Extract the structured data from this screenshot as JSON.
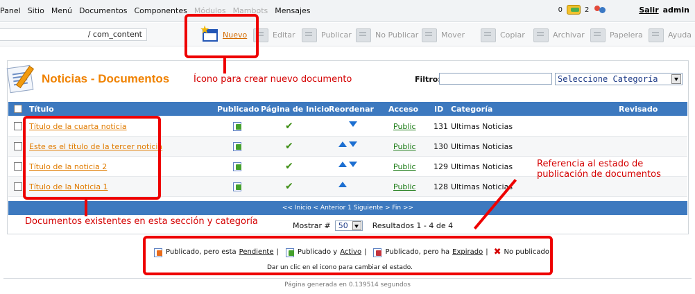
{
  "menu": {
    "items": [
      "Panel",
      "Sitio",
      "Menú",
      "Documentos",
      "Componentes"
    ],
    "faded_items": [
      "Módulos",
      "Mambots"
    ],
    "last_item": "Mensajes",
    "messages_count": "0",
    "users_count": "2",
    "logout_label": "Salir",
    "username": "admin"
  },
  "toolbar": {
    "path": "/ com_content",
    "buttons": [
      {
        "label": "Nuevo",
        "icon": "new-document-icon"
      },
      {
        "label": "Editar",
        "icon": "edit-icon"
      },
      {
        "label": "Publicar",
        "icon": "publish-icon"
      },
      {
        "label": "No Publicar",
        "icon": "unpublish-icon"
      },
      {
        "label": "Mover",
        "icon": "move-icon"
      },
      {
        "label": "Copiar",
        "icon": "copy-icon"
      },
      {
        "label": "Archivar",
        "icon": "archive-icon"
      },
      {
        "label": "Papelera",
        "icon": "trash-icon"
      },
      {
        "label": "Ayuda",
        "icon": "help-icon"
      }
    ]
  },
  "page": {
    "title": "Noticias - Documentos",
    "filter_label": "Filtro:",
    "filter_value": "",
    "category_select": "Seleccione Categoría"
  },
  "table": {
    "columns": [
      "Título",
      "Publicado",
      "Página de Inicio",
      "Reordenar",
      "Acceso",
      "ID",
      "Categoría",
      "Revisado"
    ],
    "rows": [
      {
        "title": "Título de la cuarta noticia",
        "access": "Public",
        "id": "131",
        "category": "Ultimas Noticias"
      },
      {
        "title": "Este es el título de la tercer noticia",
        "access": "Public",
        "id": "130",
        "category": "Ultimas Noticias"
      },
      {
        "title": "Título de la noticia 2",
        "access": "Public",
        "id": "129",
        "category": "Ultimas Noticias"
      },
      {
        "title": "Título de la Noticia 1",
        "access": "Public",
        "id": "128",
        "category": "Ultimas Noticias"
      }
    ],
    "pager": "<< Inicio < Anterior 1 Siguiente > Fin >>",
    "show_label": "Mostrar #",
    "show_value": "50",
    "results": "Resultados 1 - 4 de 4"
  },
  "legend": {
    "pending_text": "Publicado, pero esta",
    "pending_word": "Pendiente",
    "active_text": "Publicado y",
    "active_word": "Activo",
    "expired_text": "Publicado, pero ha",
    "expired_word": "Expirado",
    "unpublished": "No publicado",
    "hint": "Dar un clic en el icono para cambiar el estado."
  },
  "annotations": {
    "new_icon": "Ícono para crear nuevo documento",
    "documents": "Documentos existentes en esta sección y categoría",
    "status_line1": "Referencia al estado de",
    "status_line2": "publicación de documentos"
  },
  "footer": "Página generada en 0.139514 segundos",
  "colors": {
    "accent": "#f08200",
    "table_header": "#3d79bf",
    "annotation": "#ee0000"
  }
}
